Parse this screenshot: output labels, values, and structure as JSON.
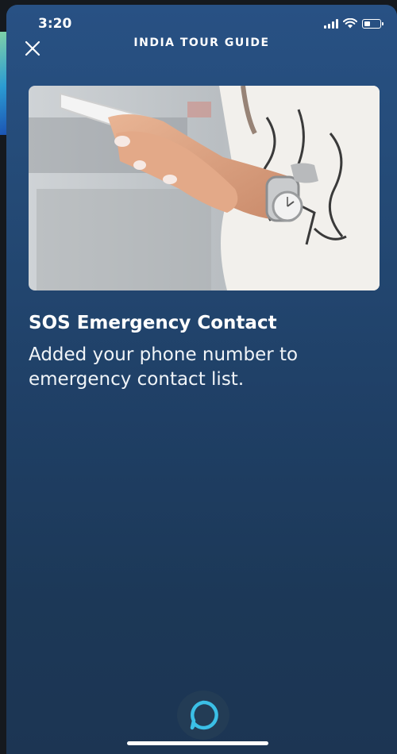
{
  "status_bar": {
    "time": "3:20"
  },
  "header": {
    "title": "INDIA TOUR GUIDE"
  },
  "card": {
    "title": "SOS Emergency Contact",
    "body": "Added your phone number to emergency contact list."
  },
  "icons": {
    "close": "close-icon",
    "alexa": "alexa-ring-icon",
    "signal": "signal-icon",
    "wifi": "wifi-icon",
    "battery": "battery-icon"
  },
  "colors": {
    "sheet_top": "#285184",
    "sheet_bottom": "#1c3553",
    "alexa_accent": "#3bbfe6"
  }
}
